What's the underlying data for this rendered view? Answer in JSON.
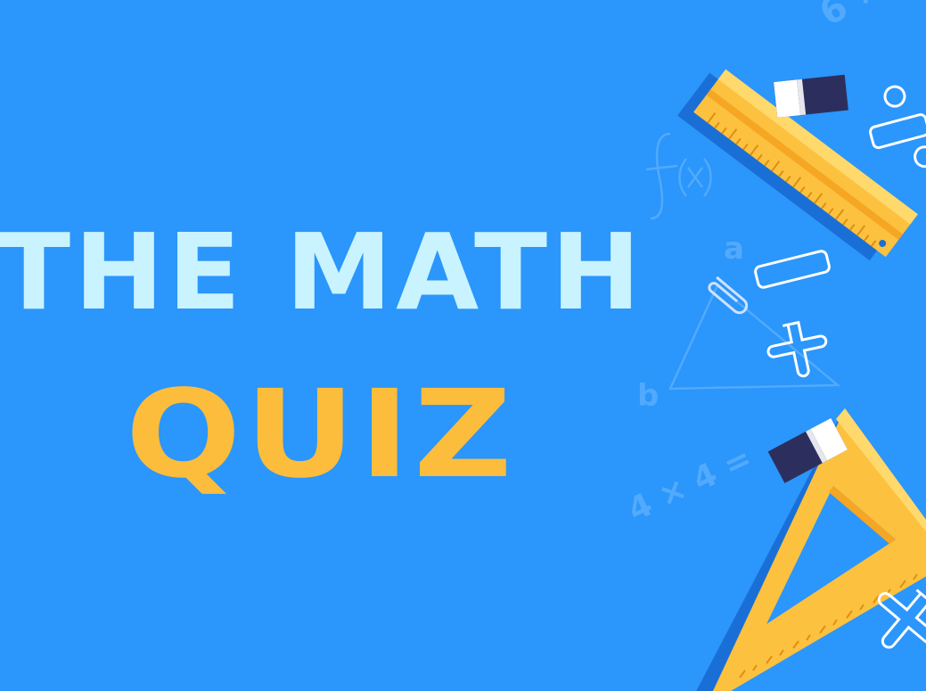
{
  "title": {
    "line1": "THE MATH",
    "line2": "QUIZ"
  },
  "colors": {
    "background": "#2b96fb",
    "line1": "#c9f3ff",
    "line2": "#fbbd3b",
    "ruler": "#fcc13f",
    "ruler_shadow": "#1a6fd6",
    "eraser_dark": "#2c2f5e",
    "eraser_light": "#ffffff"
  },
  "icons": {
    "ruler": "ruler-icon",
    "set_square": "set-square-icon",
    "eraser": "eraser-icon",
    "paperclip": "paperclip-icon",
    "plus": "plus-icon",
    "minus": "minus-icon",
    "percent": "percent-icon",
    "triangle": "triangle-sketch-icon"
  }
}
